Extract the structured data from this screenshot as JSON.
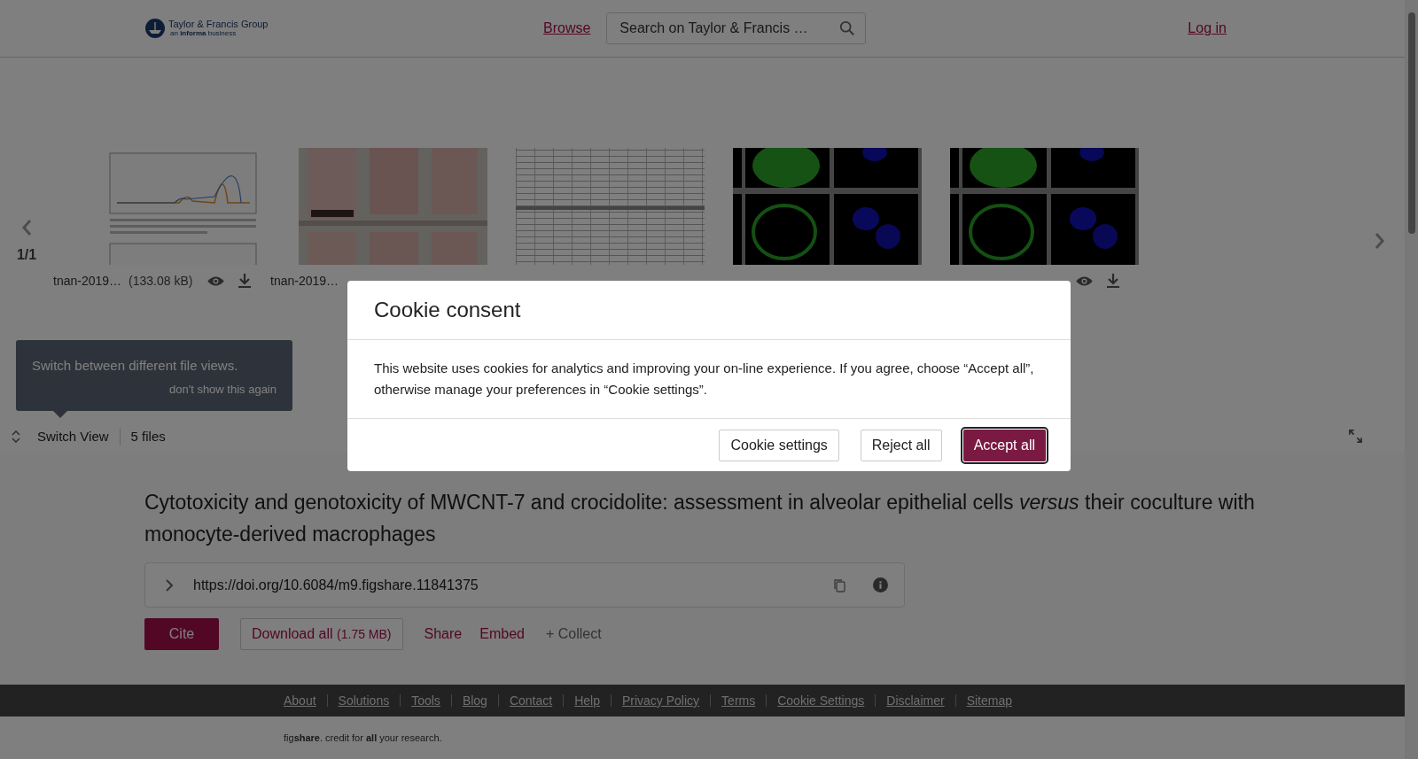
{
  "header": {
    "logo": {
      "name": "Taylor & Francis Group",
      "tagline": "an **informa** business"
    },
    "nav_link": "Browse",
    "search": {
      "placeholder": "Search on Taylor & Francis …"
    },
    "login": "Log in"
  },
  "carousel": {
    "page": "1/1",
    "files": [
      {
        "kind": "picture",
        "name": "tnan-2019…",
        "size": "(133.08 kB)",
        "icons": [
          {
            "kind": "view"
          },
          {
            "kind": "download"
          }
        ]
      },
      {
        "kind": "picture",
        "name": "tnan-2019…"
      },
      {
        "kind": "picture"
      },
      {
        "kind": "picture"
      },
      {
        "kind": "picture",
        "icons": [
          {
            "kind": "view"
          },
          {
            "kind": "download"
          }
        ]
      }
    ]
  },
  "tooltip": {
    "text": "Switch between different file views.",
    "dismiss": "don't show this again"
  },
  "view_bar": {
    "switch_label": "Switch View",
    "file_count": "5 files"
  },
  "article": {
    "title": "Cytotoxicity and genotoxicity of MWCNT-7 and crocidolite: assessment in alveolar epithelial cells *versus* their coculture with monocyte-derived macrophages",
    "doi": "https://doi.org/10.6084/m9.figshare.11841375",
    "actions": [
      {
        "kind": "primary",
        "label": "Cite"
      },
      {
        "kind": "outlined",
        "label": "Download all",
        "note": "(1.75 MB)"
      },
      {
        "kind": "link",
        "label": "Share"
      },
      {
        "kind": "link",
        "label": "Embed"
      },
      {
        "kind": "muted",
        "label": "+ Collect"
      }
    ]
  },
  "footer": {
    "links": [
      "About",
      "Solutions",
      "Tools",
      "Blog",
      "Contact",
      "Help",
      "Privacy Policy",
      "Terms",
      "Cookie Settings",
      "Disclaimer",
      "Sitemap"
    ],
    "tagline": "fig**share**. credit for **all** your research."
  },
  "cookie_dialog": {
    "title": "Cookie consent",
    "message": "This website uses cookies for analytics and improving your on-line experience. If you agree, choose “Accept all”, otherwise manage your preferences in “Cookie settings”.",
    "buttons": [
      {
        "label": "Cookie settings",
        "primary": false
      },
      {
        "label": "Reject all",
        "primary": false
      },
      {
        "label": "Accept all",
        "primary": true
      }
    ]
  }
}
